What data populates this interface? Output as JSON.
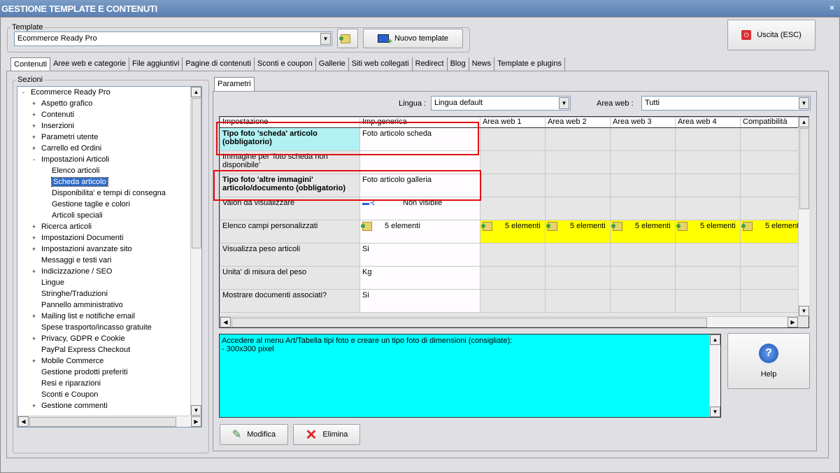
{
  "window": {
    "title": "GESTIONE TEMPLATE E CONTENUTI",
    "close": "×"
  },
  "template": {
    "legend": "Template",
    "value": "Ecommerce Ready Pro",
    "new_label": "Nuovo template"
  },
  "exit_label": "Uscita (ESC)",
  "tabs": [
    "Contenuti",
    "Aree web e categorie",
    "File aggiuntivi",
    "Pagine di contenuti",
    "Sconti e coupon",
    "Gallerie",
    "Siti web collegati",
    "Redirect",
    "Blog",
    "News",
    "Template e plugins"
  ],
  "sections": {
    "legend": "Sezioni",
    "items": [
      {
        "label": "Ecommerce Ready Pro",
        "level": 0,
        "exp": "-"
      },
      {
        "label": "Aspetto grafico",
        "level": 1,
        "exp": "+"
      },
      {
        "label": "Contenuti",
        "level": 1,
        "exp": "+"
      },
      {
        "label": "Inserzioni",
        "level": 1,
        "exp": "+"
      },
      {
        "label": "Parametri utente",
        "level": 1,
        "exp": "+"
      },
      {
        "label": "Carrello ed Ordini",
        "level": 1,
        "exp": "+"
      },
      {
        "label": "Impostazioni Articoli",
        "level": 1,
        "exp": "-"
      },
      {
        "label": "Elenco articoli",
        "level": 2,
        "exp": ""
      },
      {
        "label": "Scheda articolo",
        "level": 2,
        "exp": "",
        "selected": true
      },
      {
        "label": "Disponibilita' e tempi di consegna",
        "level": 2,
        "exp": ""
      },
      {
        "label": "Gestione taglie e colori",
        "level": 2,
        "exp": ""
      },
      {
        "label": "Articoli speciali",
        "level": 2,
        "exp": ""
      },
      {
        "label": "Ricerca articoli",
        "level": 1,
        "exp": "+"
      },
      {
        "label": "Impostazioni Documenti",
        "level": 1,
        "exp": "+"
      },
      {
        "label": "Impostazioni avanzate sito",
        "level": 1,
        "exp": "+"
      },
      {
        "label": "Messaggi e testi vari",
        "level": 1,
        "exp": ""
      },
      {
        "label": "Indicizzazione / SEO",
        "level": 1,
        "exp": "+"
      },
      {
        "label": "Lingue",
        "level": 1,
        "exp": ""
      },
      {
        "label": "Stringhe/Traduzioni",
        "level": 1,
        "exp": ""
      },
      {
        "label": "Pannello amministrativo",
        "level": 1,
        "exp": ""
      },
      {
        "label": "Mailing list e notifiche email",
        "level": 1,
        "exp": "+"
      },
      {
        "label": "Spese trasporto/incasso gratuite",
        "level": 1,
        "exp": ""
      },
      {
        "label": "Privacy, GDPR e Cookie",
        "level": 1,
        "exp": "+"
      },
      {
        "label": "PayPal Express Checkout",
        "level": 1,
        "exp": ""
      },
      {
        "label": "Mobile Commerce",
        "level": 1,
        "exp": "+"
      },
      {
        "label": "Gestione prodotti preferiti",
        "level": 1,
        "exp": ""
      },
      {
        "label": "Resi e riparazioni",
        "level": 1,
        "exp": ""
      },
      {
        "label": "Sconti e Coupon",
        "level": 1,
        "exp": ""
      },
      {
        "label": "Gestione commenti",
        "level": 1,
        "exp": "+"
      }
    ]
  },
  "params": {
    "tab": "Parametri",
    "lingua_label": "Lingua :",
    "lingua_value": "Lingua default",
    "area_label": "Area web :",
    "area_value": "Tutti"
  },
  "grid": {
    "headers": [
      "Impostazione",
      "Imp.generica",
      "Area web 1",
      "Area web 2",
      "Area web 3",
      "Area web 4",
      "Compatibilità"
    ],
    "rows": [
      {
        "name": "Tipo foto 'scheda' articolo (obbligatorio)",
        "value": "Foto articolo scheda",
        "bold": true,
        "hl": true
      },
      {
        "name": "Immagine per 'foto scheda non disponibile'",
        "value": ""
      },
      {
        "name": "Tipo foto 'altre immagini' articolo/documento (obbligatorio)",
        "value": "Foto articolo galleria",
        "bold": true
      },
      {
        "name": "Valori da visualizzare",
        "value": "Non visibile",
        "icon": "tree"
      },
      {
        "name": "Elenco campi personalizzati",
        "value": "5 elementi",
        "icon": "folder",
        "areas": "5 elementi"
      },
      {
        "name": "Visualizza peso articoli",
        "value": "Si"
      },
      {
        "name": "Unita' di misura del peso",
        "value": "Kg"
      },
      {
        "name": "Mostrare documenti associati?",
        "value": "Si"
      }
    ]
  },
  "note": "Accedere al menu Art/Tabella tipi foto e creare un tipo foto di dimensioni (consigliate):\n- 300x300 pixel",
  "help_label": "Help",
  "modifica_label": "Modifica",
  "elimina_label": "Elimina"
}
